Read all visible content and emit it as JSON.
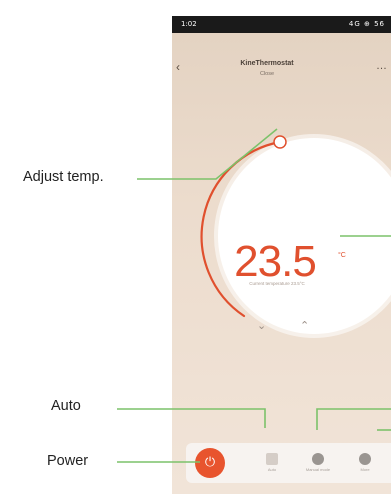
{
  "status_bar": {
    "time": "1:02",
    "signal": "4G ⊕ 56"
  },
  "header": {
    "title": "KineThermostat",
    "subtitle": "Close"
  },
  "thermostat": {
    "temperature": "23.5",
    "unit": "°C",
    "caption": "Current temperature 23.5°C",
    "setpoint_fraction": 0.33
  },
  "toolbar": {
    "items": [
      {
        "label": "Auto"
      },
      {
        "label": "Manual mode"
      },
      {
        "label": "More"
      }
    ]
  },
  "callouts": {
    "adjust_temp": "Adjust temp.",
    "auto": "Auto",
    "power": "Power"
  },
  "colors": {
    "accent": "#e0502e",
    "callout_line": "#7cc26a"
  }
}
